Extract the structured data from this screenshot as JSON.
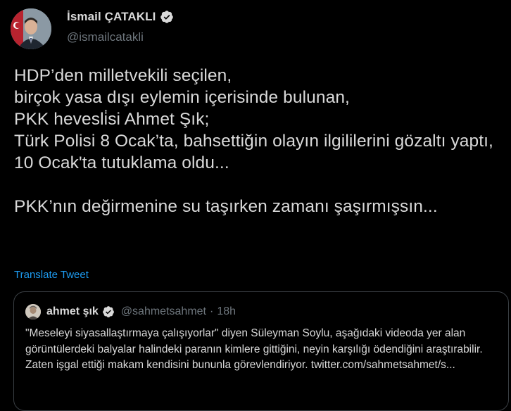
{
  "tweet": {
    "display_name": "İsmail ÇATAKLI",
    "handle": "@ismailcatakli",
    "text": "HDP’den milletvekili seçilen,\nbirçok yasa dışı eylemin içerisinde bulunan,\nPKK hevesli̇si Ahmet Şık;\nTürk Polisi 8 Ocak’ta, bahsettiğin olayın ilgililerini gözaltı yaptı,\n10 Ocak't­a tutuklama oldu...\n\nPKK’nın değirmenine su taşırken zamanı şaşırmışsın...",
    "translate_label": "Translate Tweet"
  },
  "quoted_tweet": {
    "display_name": "ahmet şık",
    "handle": "@sahmetsahmet",
    "separator": "·",
    "time": "18h",
    "text": "\"Meseleyi siyasallaştırmaya çalışıyorlar\" diyen Süleyman Soylu, aşağıdaki videoda yer alan görüntülerdeki balyalar halindeki paranın kimlere gittiğini, neyin karşılığı ödendiğini araştırabilir. Zaten işgal ettiği makam kendisini bununla görevlendiriyor. twitter.com/sahmetsahmet/s..."
  },
  "colors": {
    "background": "#000000",
    "text": "#d9d9d9",
    "secondary_text": "#6e767d",
    "link": "#1d9bf0",
    "verified_badge": "#d9d9d9",
    "border": "#3a3f44"
  },
  "icons": {
    "verified": "verified-badge-icon",
    "avatar": "profile-avatar",
    "quoted_avatar": "quoted-profile-avatar"
  }
}
